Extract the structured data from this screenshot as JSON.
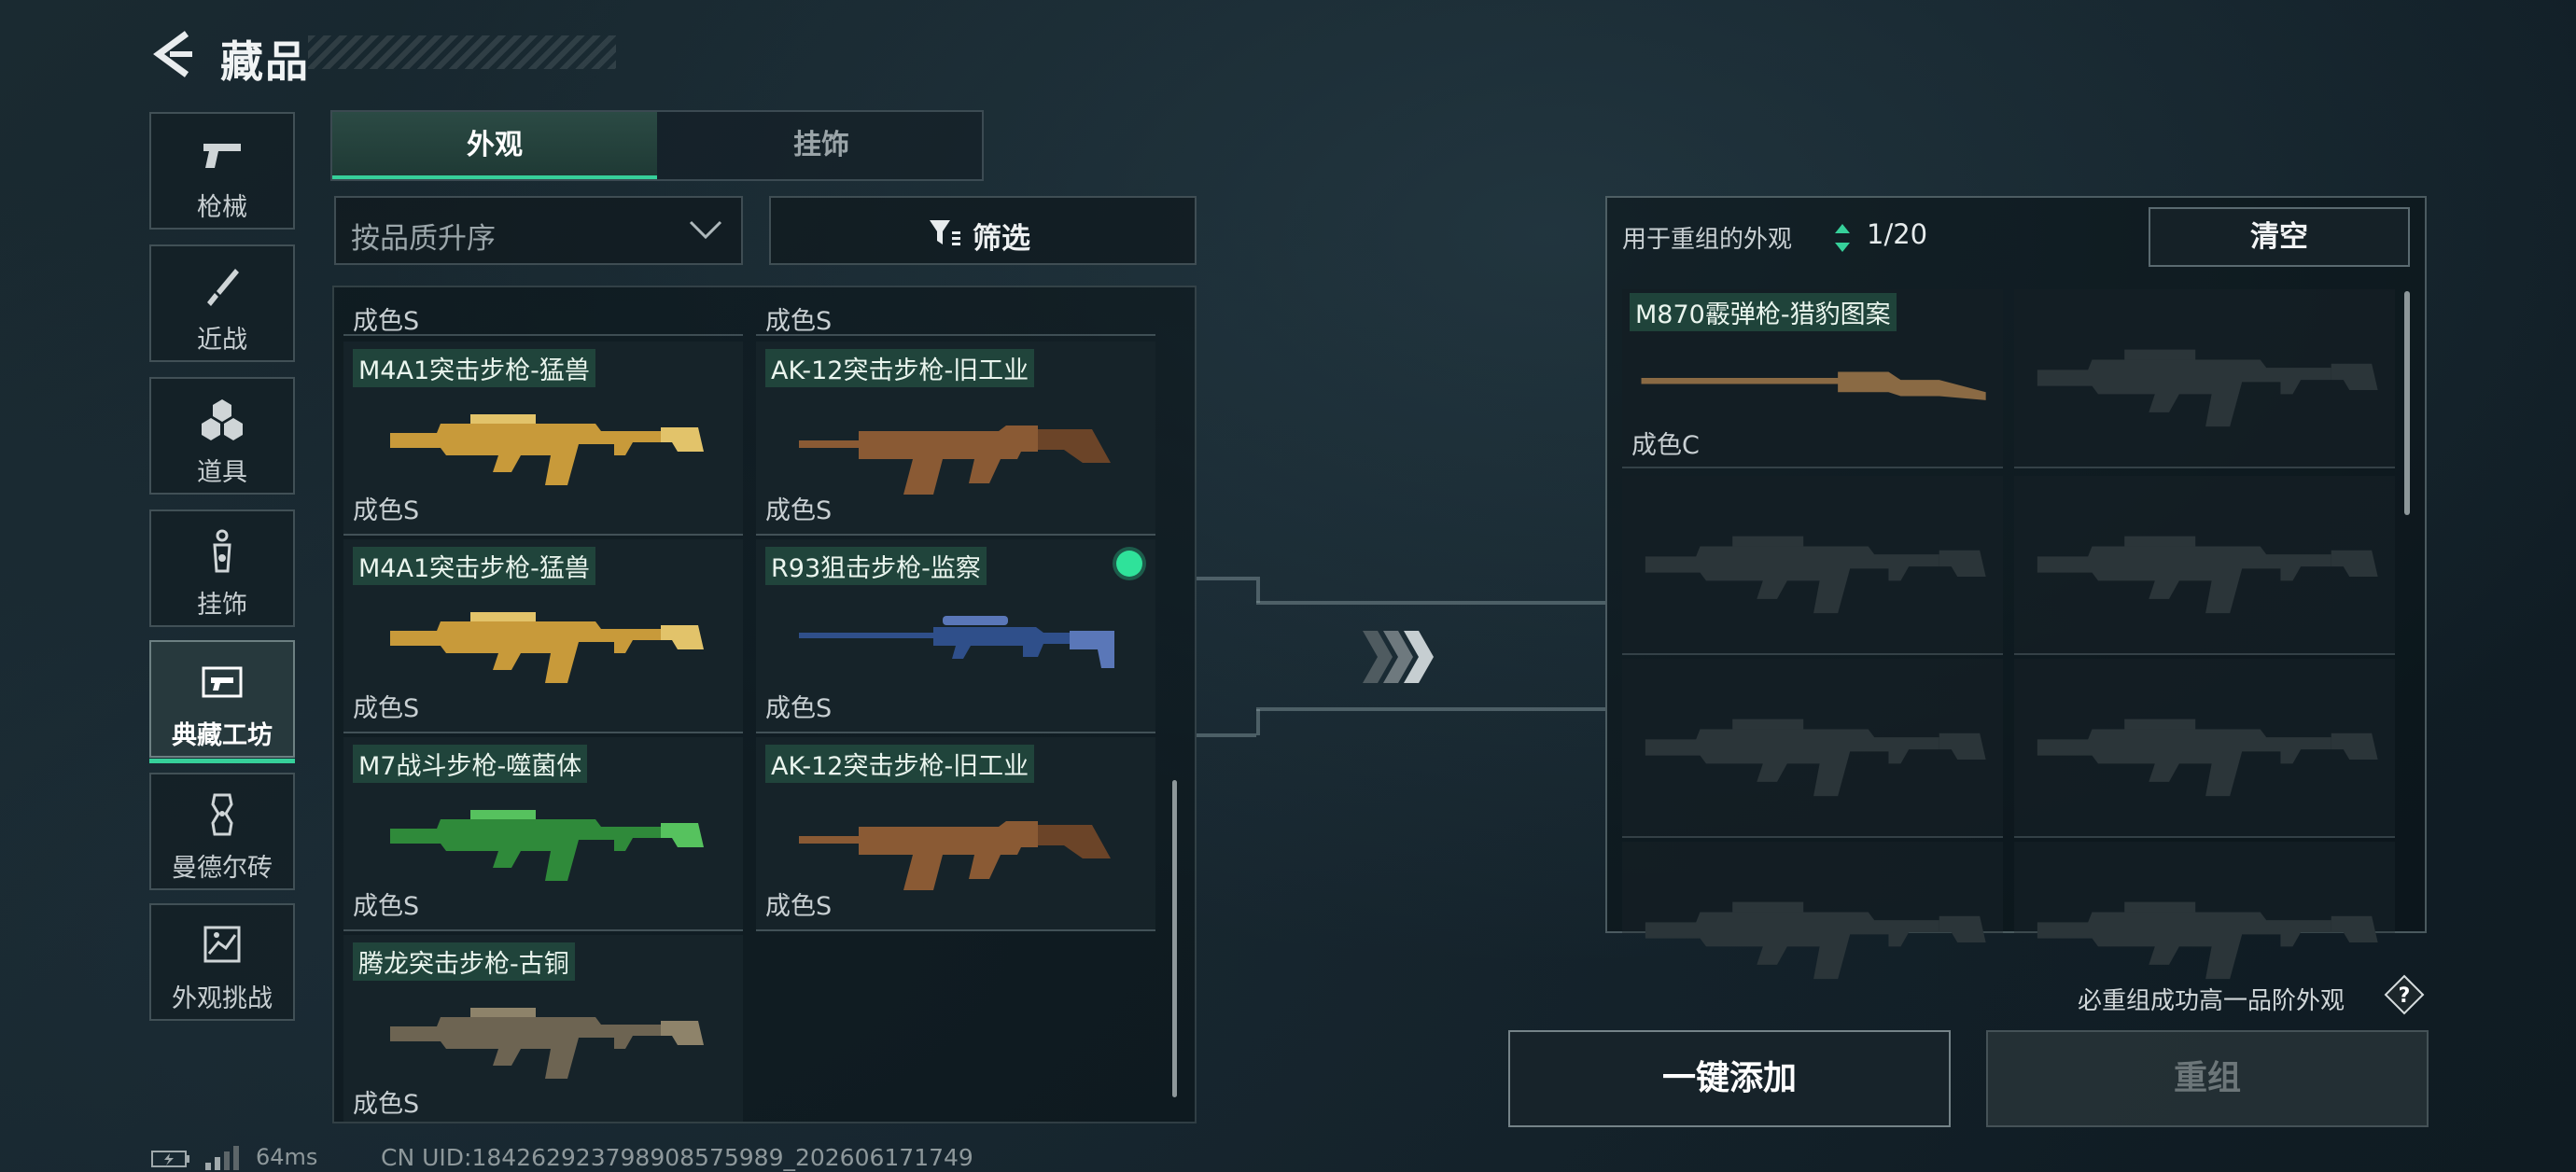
{
  "header": {
    "title": "藏品"
  },
  "sidebar": {
    "items": [
      {
        "label": "枪械",
        "icon": "pistol-icon"
      },
      {
        "label": "近战",
        "icon": "knife-icon"
      },
      {
        "label": "道具",
        "icon": "grenade-icon"
      },
      {
        "label": "挂饰",
        "icon": "charm-icon"
      },
      {
        "label": "典藏工坊",
        "icon": "workshop-icon",
        "active": true
      },
      {
        "label": "曼德尔砖",
        "icon": "brick-icon"
      },
      {
        "label": "外观挑战",
        "icon": "challenge-icon"
      }
    ]
  },
  "tabs": [
    {
      "label": "外观",
      "active": true
    },
    {
      "label": "挂饰",
      "active": false
    }
  ],
  "sort": {
    "value": "按品质升序"
  },
  "filter": {
    "label": "筛选"
  },
  "list": {
    "top_grades": [
      "成色S",
      "成色S"
    ],
    "items": [
      {
        "name": "M4A1突击步枪-猛兽",
        "grade": "成色S",
        "skin": "tiger"
      },
      {
        "name": "AK-12突击步枪-旧工业",
        "grade": "成色S",
        "skin": "rust"
      },
      {
        "name": "M4A1突击步枪-猛兽",
        "grade": "成色S",
        "skin": "tiger"
      },
      {
        "name": "R93狙击步枪-监察",
        "grade": "成色S",
        "skin": "blue",
        "selected": true
      },
      {
        "name": "M7战斗步枪-噬菌体",
        "grade": "成色S",
        "skin": "green"
      },
      {
        "name": "AK-12突击步枪-旧工业",
        "grade": "成色S",
        "skin": "rust"
      },
      {
        "name": "腾龙突击步枪-古铜",
        "grade": "成色S",
        "skin": "bronze"
      }
    ]
  },
  "recombine": {
    "label": "用于重组的外观",
    "count": "1/20",
    "clear_label": "清空",
    "slots": [
      {
        "name": "M870霰弹枪-猎豹图案",
        "grade": "成色C",
        "filled": true
      }
    ],
    "guarantee": "必重组成功高一品阶外观",
    "add_all_label": "一键添加",
    "recombine_label": "重组"
  },
  "status": {
    "ping": "64ms",
    "uid": "CN UID:184262923798908575989_202606171749"
  },
  "colors": {
    "accent": "#36d09a",
    "tag_bg": "#224a3e",
    "select_dot": "#2fe29a"
  }
}
